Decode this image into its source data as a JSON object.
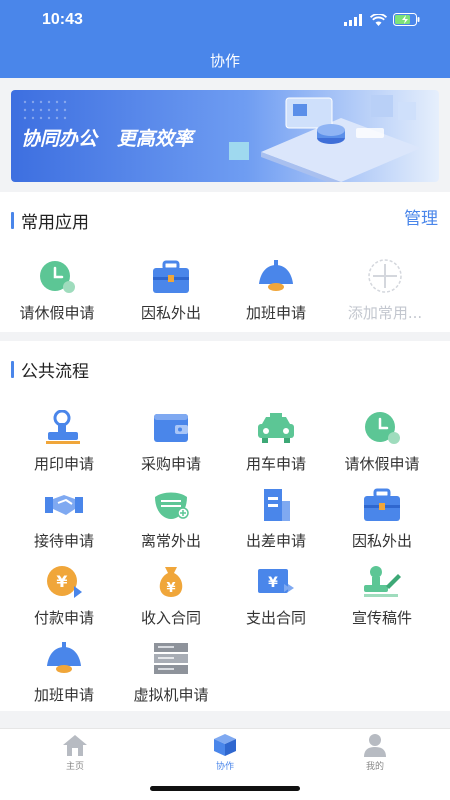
{
  "status": {
    "time": "10:43"
  },
  "header": {
    "title": "协作"
  },
  "banner": {
    "text": "协同办公   更高效率"
  },
  "common_apps": {
    "title": "常用应用",
    "manage_label": "管理",
    "items": [
      {
        "label": "请休假申请",
        "icon": "clock-icon"
      },
      {
        "label": "因私外出",
        "icon": "briefcase-icon"
      },
      {
        "label": "加班申请",
        "icon": "lamp-icon"
      },
      {
        "label": "添加常用...",
        "icon": "add-icon"
      }
    ]
  },
  "public_flow": {
    "title": "公共流程",
    "items": [
      {
        "label": "用印申请",
        "icon": "stamp-icon"
      },
      {
        "label": "采购申请",
        "icon": "wallet-icon"
      },
      {
        "label": "用车申请",
        "icon": "car-icon"
      },
      {
        "label": "请休假申请",
        "icon": "clock-icon"
      },
      {
        "label": "接待申请",
        "icon": "handshake-icon"
      },
      {
        "label": "离常外出",
        "icon": "mask-icon"
      },
      {
        "label": "出差申请",
        "icon": "building-icon"
      },
      {
        "label": "因私外出",
        "icon": "briefcase-icon"
      },
      {
        "label": "付款申请",
        "icon": "yen-coin-icon"
      },
      {
        "label": "收入合同",
        "icon": "money-bag-icon"
      },
      {
        "label": "支出合同",
        "icon": "yen-card-icon"
      },
      {
        "label": "宣传稿件",
        "icon": "stamp-pen-icon"
      },
      {
        "label": "加班申请",
        "icon": "lamp-icon"
      },
      {
        "label": "虚拟机申请",
        "icon": "server-icon"
      }
    ]
  },
  "tabbar": {
    "items": [
      {
        "label": "主页",
        "icon": "home-icon"
      },
      {
        "label": "协作",
        "icon": "cube-icon"
      },
      {
        "label": "我的",
        "icon": "person-icon"
      }
    ]
  },
  "colors": {
    "primary": "#4a86ea",
    "green": "#5cc695",
    "orange": "#f0a63a"
  }
}
